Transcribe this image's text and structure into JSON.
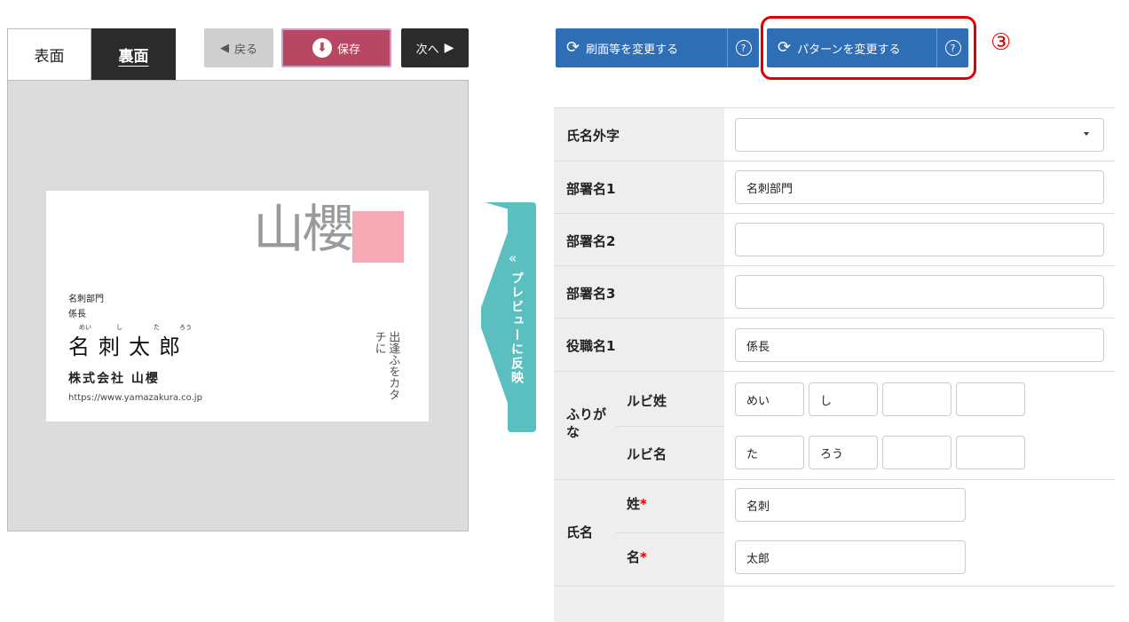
{
  "preview": {
    "tabs": [
      {
        "label": "表面"
      },
      {
        "label": "裏面"
      }
    ],
    "back_label": "戻る",
    "save_label": "保存",
    "next_label": "次へ",
    "reflect_label": "プレビューに反映",
    "card": {
      "logo": "山櫻",
      "dept": "名刺部門",
      "title": "係長",
      "ruby": [
        "めい",
        "し",
        "た",
        "ろう"
      ],
      "name": "名刺太郎",
      "company": "株式会社 山櫻",
      "url": "https://www.yamazakura.co.jp",
      "vertical": "出逢ふをカタチに"
    }
  },
  "toolbar": {
    "change_print_label": "刷面等を変更する",
    "change_pattern_label": "パターンを変更する",
    "help_label": "?",
    "step_marker": "③"
  },
  "form": {
    "rows": [
      {
        "label": "氏名外字",
        "value": ""
      },
      {
        "label": "部署名1",
        "value": "名刺部門"
      },
      {
        "label": "部署名2",
        "value": ""
      },
      {
        "label": "部署名3",
        "value": ""
      },
      {
        "label": "役職名1",
        "value": "係長"
      }
    ],
    "furigana": {
      "label": "ふりがな",
      "sei_label": "ルビ姓",
      "sei_values": [
        "めい",
        "し",
        "",
        ""
      ],
      "mei_label": "ルビ名",
      "mei_values": [
        "た",
        "ろう",
        "",
        ""
      ]
    },
    "name": {
      "label": "氏名",
      "sei_label": "姓",
      "sei_value": "名刺",
      "mei_label": "名",
      "mei_value": "太郎",
      "required_mark": "*"
    }
  },
  "colors": {
    "primary_blue": "#2f6db5",
    "save_red": "#b84763",
    "reflect_teal": "#5bbfc0",
    "highlight_red": "#e00000",
    "logo_pink": "#f6a8b4"
  }
}
